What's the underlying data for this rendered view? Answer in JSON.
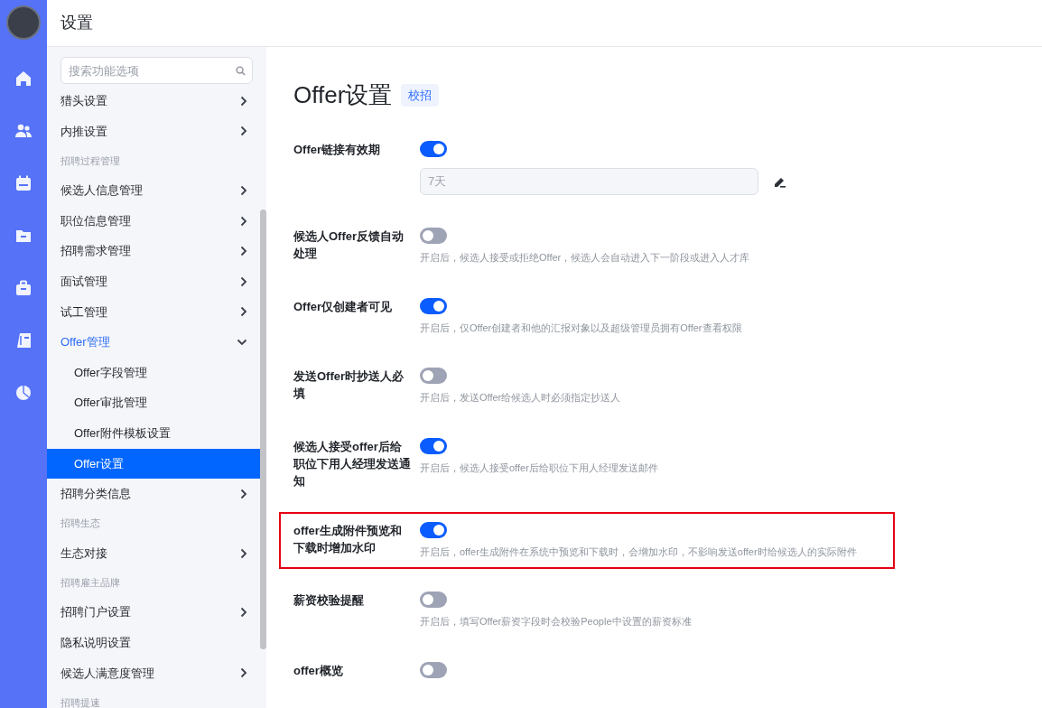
{
  "header": {
    "title": "设置"
  },
  "rail": {
    "items": [
      {
        "kind": "home",
        "selected": false
      },
      {
        "kind": "people",
        "selected": false
      },
      {
        "kind": "calendar",
        "selected": false
      },
      {
        "kind": "folder",
        "selected": false
      },
      {
        "kind": "briefcase",
        "selected": false
      },
      {
        "kind": "book",
        "selected": false
      },
      {
        "kind": "pie",
        "selected": false
      }
    ]
  },
  "sidebar": {
    "search": {
      "placeholder": "搜索功能选项"
    },
    "items": [
      {
        "kind": "item",
        "label": "猎头设置",
        "expanded": false
      },
      {
        "kind": "item",
        "label": "内推设置",
        "expanded": false
      },
      {
        "kind": "section",
        "label": "招聘过程管理"
      },
      {
        "kind": "item",
        "label": "候选人信息管理",
        "expanded": false
      },
      {
        "kind": "item",
        "label": "职位信息管理",
        "expanded": false
      },
      {
        "kind": "item",
        "label": "招聘需求管理",
        "expanded": false
      },
      {
        "kind": "item",
        "label": "面试管理",
        "expanded": false
      },
      {
        "kind": "item",
        "label": "试工管理",
        "expanded": false
      },
      {
        "kind": "item",
        "label": "Offer管理",
        "expanded": true,
        "children": [
          {
            "label": "Offer字段管理",
            "selected": false
          },
          {
            "label": "Offer审批管理",
            "selected": false
          },
          {
            "label": "Offer附件模板设置",
            "selected": false
          },
          {
            "label": "Offer设置",
            "selected": true
          }
        ]
      },
      {
        "kind": "item",
        "label": "招聘分类信息",
        "expanded": false
      },
      {
        "kind": "section",
        "label": "招聘生态"
      },
      {
        "kind": "item",
        "label": "生态对接",
        "expanded": false
      },
      {
        "kind": "section",
        "label": "招聘雇主品牌"
      },
      {
        "kind": "item",
        "label": "招聘门户设置",
        "expanded": false
      },
      {
        "kind": "link",
        "label": "隐私说明设置"
      },
      {
        "kind": "item",
        "label": "候选人满意度管理",
        "expanded": false
      },
      {
        "kind": "section",
        "label": "招聘提速"
      }
    ]
  },
  "page": {
    "title": "Offer设置",
    "tag": "校招",
    "settings": [
      {
        "label": "Offer链接有效期",
        "on": true,
        "field": {
          "value": "7天"
        },
        "highlighted": false
      },
      {
        "label": "候选人Offer反馈自动处理",
        "on": false,
        "description": "开启后，候选人接受或拒绝Offer，候选人会自动进入下一阶段或进入人才库",
        "highlighted": false
      },
      {
        "label": "Offer仅创建者可见",
        "on": true,
        "description": "开启后，仅Offer创建者和他的汇报对象以及超级管理员拥有Offer查看权限",
        "highlighted": false
      },
      {
        "label": "发送Offer时抄送人必填",
        "on": false,
        "description": "开启后，发送Offer给候选人时必须指定抄送人",
        "highlighted": false
      },
      {
        "label": "候选人接受offer后给职位下用人经理发送通知",
        "on": true,
        "description": "开启后，候选人接受offer后给职位下用人经理发送邮件",
        "highlighted": false
      },
      {
        "label": "offer生成附件预览和下载时增加水印",
        "on": true,
        "description": "开启后，offer生成附件在系统中预览和下载时，会增加水印，不影响发送offer时给候选人的实际附件",
        "highlighted": true
      },
      {
        "label": "薪资校验提醒",
        "on": false,
        "description": "开启后，填写Offer薪资字段时会校验People中设置的薪资标准",
        "highlighted": false
      },
      {
        "label": "offer概览",
        "on": false,
        "highlighted": false
      }
    ]
  }
}
